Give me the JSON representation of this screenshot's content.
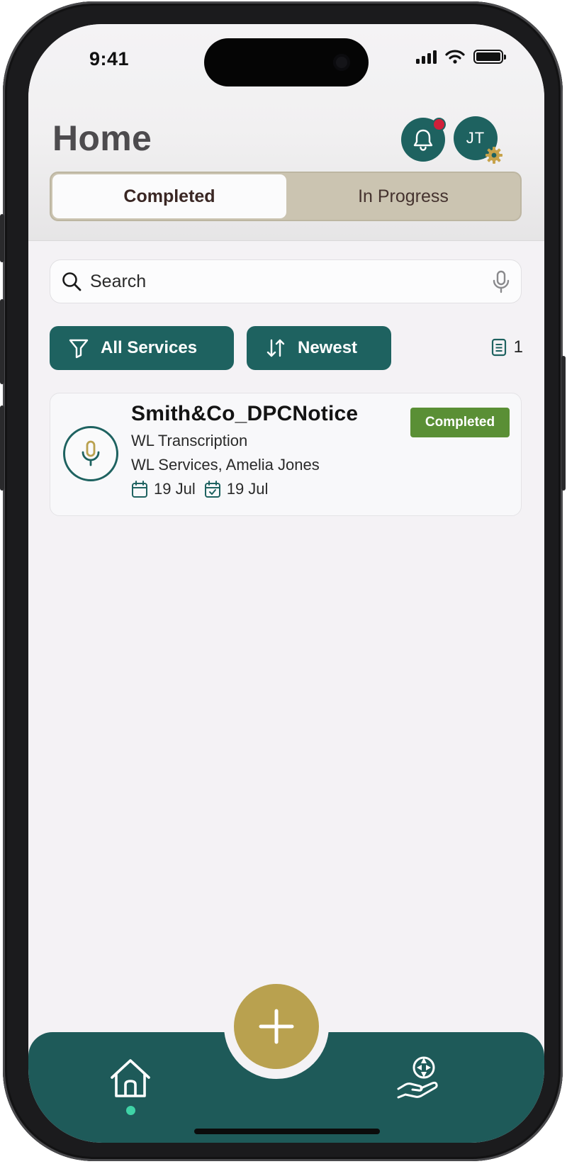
{
  "status_bar": {
    "time": "9:41"
  },
  "header": {
    "title": "Home",
    "avatar_initials": "JT"
  },
  "tabs": [
    {
      "label": "Completed",
      "active": true
    },
    {
      "label": "In Progress",
      "active": false
    }
  ],
  "search": {
    "placeholder": "Search"
  },
  "filters": {
    "service_filter_label": "All Services",
    "sort_label": "Newest",
    "result_count": "1"
  },
  "items": [
    {
      "title": "Smith&Co_DPCNotice",
      "service": "WL Transcription",
      "provider": "WL Services, Amelia Jones",
      "start_date": "19 Jul",
      "end_date": "19 Jul",
      "status": "Completed"
    }
  ],
  "colors": {
    "primary": "#1e6260",
    "accent_gold": "#b9a14f",
    "status_completed": "#5a8f35",
    "notification": "#d0203a",
    "active_nav_dot": "#3fd3a6"
  },
  "icons": [
    "bell-icon",
    "gear-icon",
    "search-icon",
    "microphone-icon",
    "filter-icon",
    "sort-icon",
    "document-icon",
    "calendar-icon",
    "calendar-check-icon",
    "plus-icon",
    "home-icon",
    "hand-globe-icon"
  ]
}
